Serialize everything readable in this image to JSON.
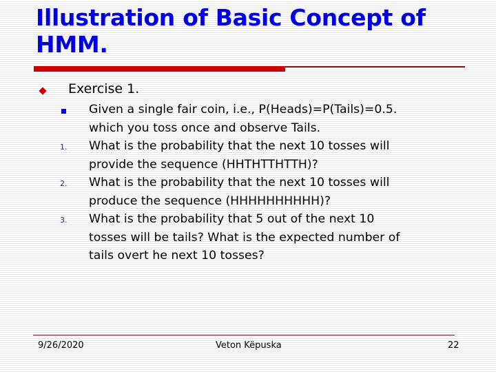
{
  "slide": {
    "title": "Illustration of Basic Concept of HMM.",
    "bullet": "Exercise 1.",
    "given_lines": [
      "Given a single fair coin, i.e., P(Heads)=P(Tails)=0.5.",
      "which you toss once and observe Tails."
    ],
    "questions": [
      {
        "number": "1.",
        "lines": [
          "What is the probability that the next 10 tosses will",
          "provide the sequence (HHTHTTHTTH)?"
        ]
      },
      {
        "number": "2.",
        "lines": [
          "What is the probability that the next 10 tosses will",
          "produce the sequence (HHHHHHHHHH)?"
        ]
      },
      {
        "number": "3.",
        "lines": [
          "What is the probability that 5 out of the next 10",
          "tosses will be tails? What is the expected number of",
          "tails overt he next 10 tosses?"
        ]
      }
    ]
  },
  "footer": {
    "date": "9/26/2020",
    "author": "Veton Këpuska",
    "page": "22"
  },
  "colors": {
    "title": "#0000e0",
    "accent_bar": "#cc0000",
    "bullet_l1": "#cc0000",
    "bullet_l2": "#0000dd"
  }
}
